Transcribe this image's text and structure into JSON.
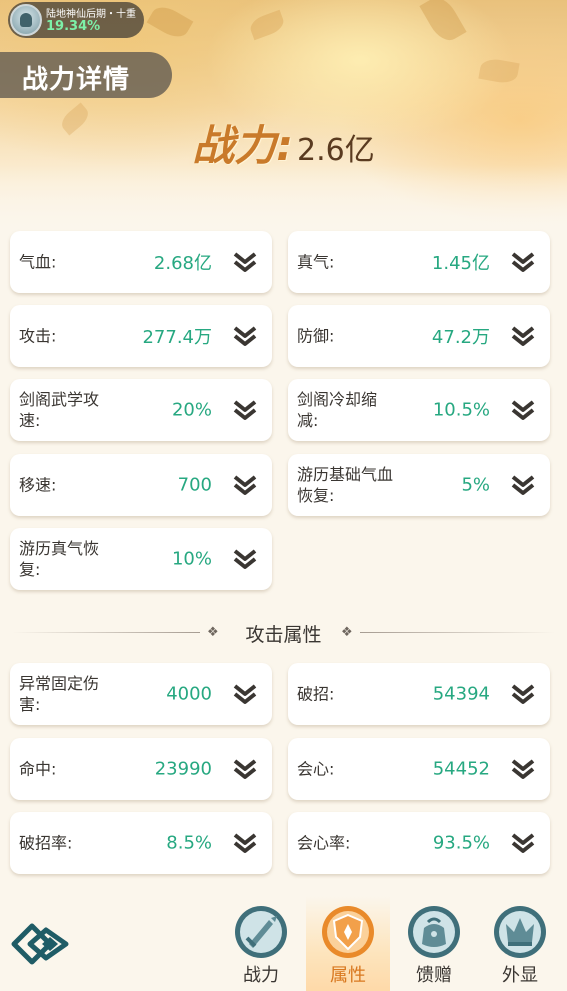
{
  "player": {
    "realm": "陆地神仙后期・十重",
    "progress": "19.34%"
  },
  "page": {
    "title": "战力详情"
  },
  "power": {
    "label": "战力:",
    "value": "2.6亿"
  },
  "stats": [
    {
      "label": "气血:",
      "value": "2.68亿"
    },
    {
      "label": "真气:",
      "value": "1.45亿"
    },
    {
      "label": "攻击:",
      "value": "277.4万"
    },
    {
      "label": "防御:",
      "value": "47.2万"
    },
    {
      "label": "剑阁武学攻速:",
      "value": "20%"
    },
    {
      "label": "剑阁冷却缩减:",
      "value": "10.5%"
    },
    {
      "label": "移速:",
      "value": "700"
    },
    {
      "label": "游历基础气血恢复:",
      "value": "5%"
    },
    {
      "label": "游历真气恢复:",
      "value": "10%"
    }
  ],
  "attack_section": {
    "title": "攻击属性",
    "stats": [
      {
        "label": "异常固定伤害:",
        "value": "4000"
      },
      {
        "label": "破招:",
        "value": "54394"
      },
      {
        "label": "命中:",
        "value": "23990"
      },
      {
        "label": "会心:",
        "value": "54452"
      },
      {
        "label": "破招率:",
        "value": "8.5%"
      },
      {
        "label": "会心率:",
        "value": "93.5%"
      }
    ]
  },
  "nav": {
    "items": [
      {
        "label": "战力",
        "icon": "sword-icon"
      },
      {
        "label": "属性",
        "icon": "shield-icon"
      },
      {
        "label": "馈赠",
        "icon": "gift-bag-icon"
      },
      {
        "label": "外显",
        "icon": "crown-icon"
      }
    ],
    "active_index": 1
  },
  "colors": {
    "value_green": "#27a881",
    "power_orange": "#c97a2a",
    "active_orange": "#d9781f"
  }
}
